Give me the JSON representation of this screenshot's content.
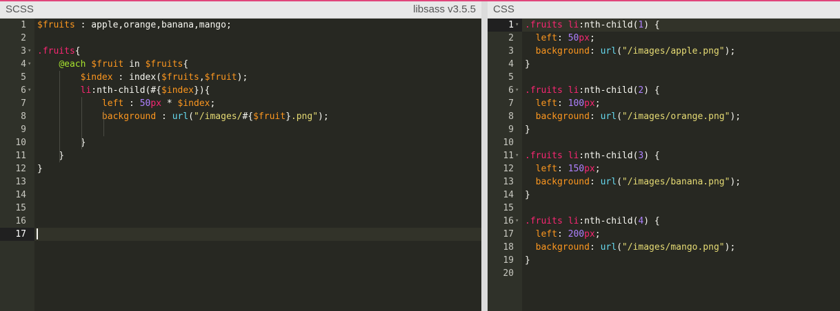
{
  "scss_pane": {
    "title": "SCSS",
    "version": "libsass v3.5.5",
    "active_line": 17,
    "line_numbers": [
      "1",
      "2",
      "3",
      "4",
      "5",
      "6",
      "7",
      "8",
      "9",
      "10",
      "11",
      "12",
      "13",
      "14",
      "15",
      "16",
      "17"
    ],
    "fold_lines": [
      3,
      4,
      6
    ],
    "lines": [
      "$fruits : apple,orange,banana,mango;",
      "",
      ".fruits{",
      "    @each $fruit in $fruits{",
      "        $index : index($fruits,$fruit);",
      "        li:nth-child(#{$index}){",
      "            left : 50px * $index;",
      "            background : url(\"/images/#{$fruit}.png\");",
      "",
      "        }",
      "    }",
      "}",
      "",
      "",
      "",
      "",
      ""
    ]
  },
  "css_pane": {
    "title": "CSS",
    "active_line": 1,
    "line_numbers": [
      "1",
      "2",
      "3",
      "4",
      "5",
      "6",
      "7",
      "8",
      "9",
      "10",
      "11",
      "12",
      "13",
      "14",
      "15",
      "16",
      "17",
      "18",
      "19",
      "20"
    ],
    "fold_lines": [
      1,
      6,
      11,
      16
    ],
    "lines": [
      ".fruits li:nth-child(1) {",
      "  left: 50px;",
      "  background: url(\"/images/apple.png\");",
      "}",
      "",
      ".fruits li:nth-child(2) {",
      "  left: 100px;",
      "  background: url(\"/images/orange.png\");",
      "}",
      "",
      ".fruits li:nth-child(3) {",
      "  left: 150px;",
      "  background: url(\"/images/banana.png\");",
      "}",
      "",
      ".fruits li:nth-child(4) {",
      "  left: 200px;",
      "  background: url(\"/images/mango.png\");",
      "}",
      ""
    ]
  },
  "icons": {
    "fold": "chevron-down-icon"
  },
  "colors": {
    "editor_bg": "#272822",
    "gutter_bg": "#2f3129",
    "header_bg": "#e8e8e8",
    "accent_line": "#e0457b",
    "variable": "#fd971f",
    "selector": "#a6e22e",
    "number": "#ae81ff",
    "string": "#e6db74",
    "function": "#66d9ef",
    "keyword": "#f92672"
  }
}
